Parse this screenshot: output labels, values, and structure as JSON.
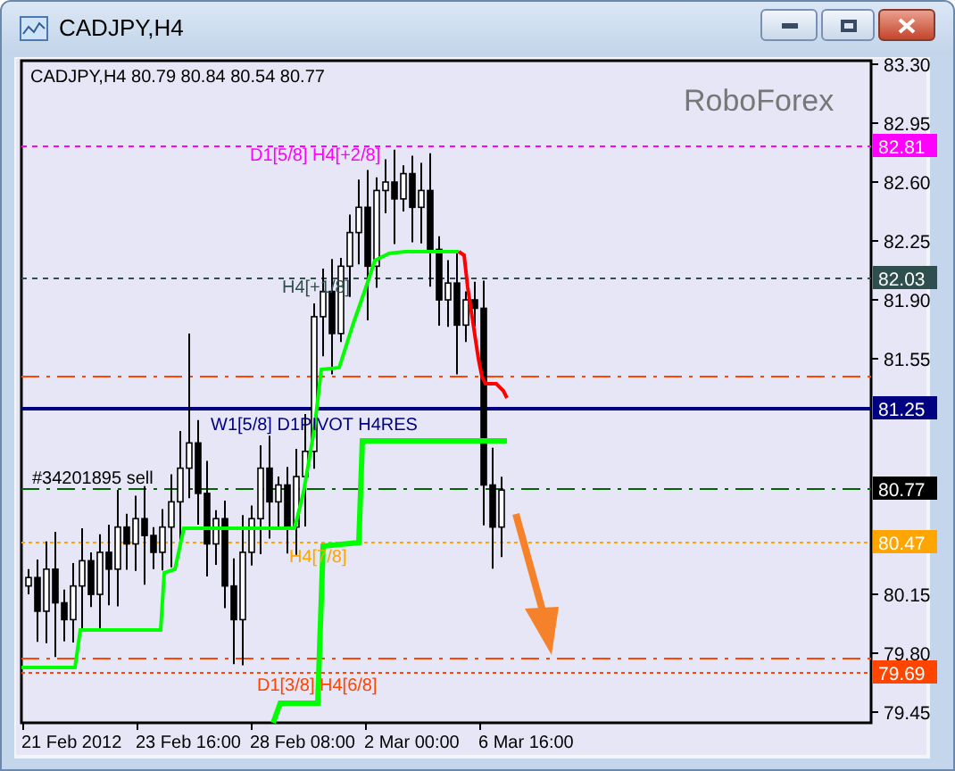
{
  "window": {
    "title": "CADJPY,H4"
  },
  "chart": {
    "header": "CADJPY,H4  80.79 80.84 80.54 80.77",
    "brand_label": "RoboForex",
    "price_ticks": [
      "83.30",
      "82.95",
      "82.60",
      "82.25",
      "81.90",
      "81.55",
      "80.15",
      "79.80",
      "79.45"
    ],
    "time_labels": [
      "21 Feb 2012",
      "23 Feb 16:00",
      "28 Feb 08:00",
      "2 Mar 00:00",
      "6 Mar 16:00"
    ],
    "levels": [
      {
        "kind": "dashed",
        "label": "D1[5/8] H4[+2/8]",
        "price_tag": "82.81",
        "color": "#ff00ff"
      },
      {
        "kind": "dashed",
        "label": "H4[+1/8]",
        "price_tag": "82.03",
        "color": "#2f4f4f"
      },
      {
        "kind": "solid",
        "label": "W1[5/8] D1PIVOT H4RES",
        "price_tag": "81.25",
        "color": "#000080"
      },
      {
        "kind": "dashdot",
        "label": "#34201895 sell",
        "price_tag": "80.77",
        "color": "#000000"
      },
      {
        "kind": "dotted",
        "label": "H4[7/8]",
        "price_tag": "80.47",
        "color": "#ffa500"
      },
      {
        "kind": "dotted",
        "label": "D1[3/8] H4[6/8]",
        "price_tag": "79.69",
        "color": "#ff4500"
      }
    ]
  }
}
